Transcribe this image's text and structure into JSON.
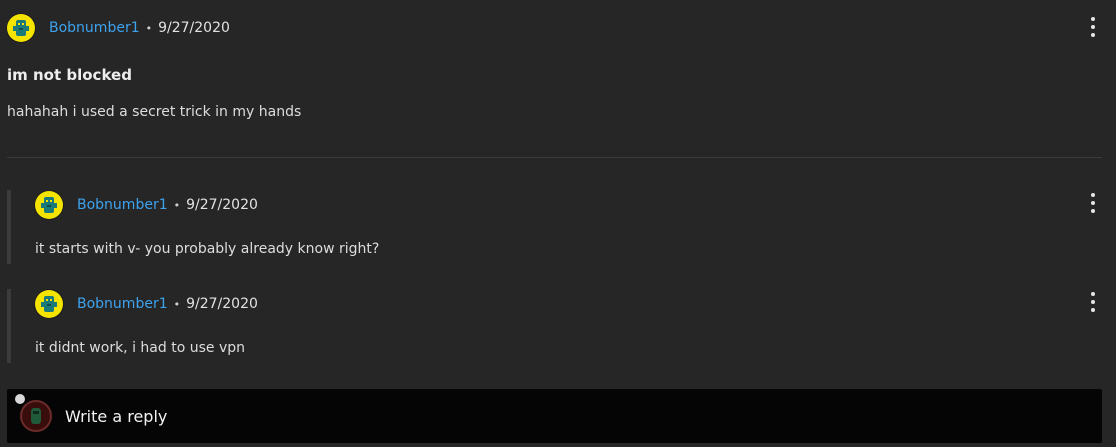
{
  "post": {
    "author": "Bobnumber1",
    "separator": "•",
    "date": "9/27/2020",
    "title": "im not blocked",
    "body": "hahahah i used a secret trick in my hands"
  },
  "replies": [
    {
      "author": "Bobnumber1",
      "separator": "•",
      "date": "9/27/2020",
      "body": "it starts with v- you probably already know right?"
    },
    {
      "author": "Bobnumber1",
      "separator": "•",
      "date": "9/27/2020",
      "body": "it didnt work, i had to use vpn"
    }
  ],
  "reply_box": {
    "placeholder": "Write a reply"
  },
  "icons": {
    "author_avatar": "robot-avatar-icon",
    "more_menu": "kebab-menu-icon",
    "current_user_avatar": "user-avatar-icon"
  },
  "colors": {
    "background": "#262626",
    "username": "#3da3ef",
    "reply_box": "#050505",
    "avatar_yellow": "#f5e400"
  }
}
